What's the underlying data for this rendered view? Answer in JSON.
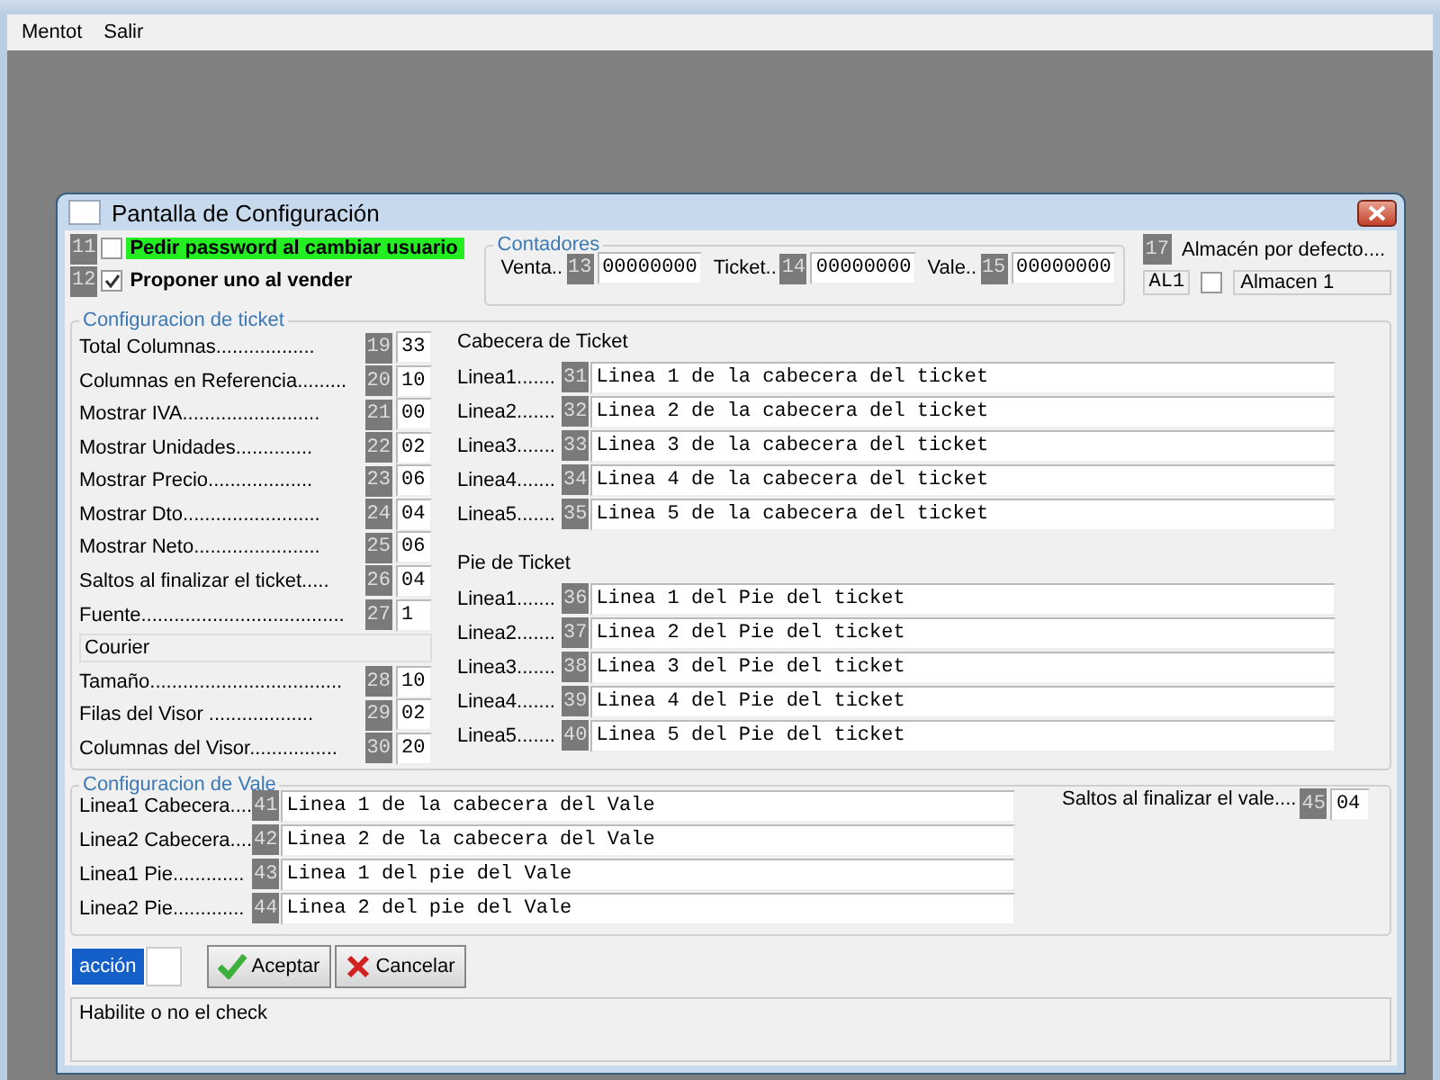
{
  "menu": [
    "Mentot",
    "Salir"
  ],
  "dialog": {
    "title": "Pantalla de Configuración",
    "options": [
      {
        "number": "11",
        "label": "Pedir password al cambiar usuario",
        "checked": false,
        "highlighted": true
      },
      {
        "number": "12",
        "label": "Proponer uno al vender",
        "checked": true,
        "highlighted": false
      }
    ],
    "contadores": {
      "title": "Contadores",
      "fields": [
        {
          "label": "Venta..",
          "number": "13",
          "value": "00000000"
        },
        {
          "label": "Ticket..",
          "number": "14",
          "value": "00000000"
        },
        {
          "label": "Vale..",
          "number": "15",
          "value": "00000000"
        }
      ]
    },
    "almacen": {
      "number": "17",
      "label": "Almacén por defecto....",
      "code": "AL1",
      "checked": false,
      "name": "Almacen 1"
    },
    "ticket_config": {
      "title": "Configuracion de ticket",
      "fields": [
        {
          "kind": "field",
          "label": "Total Columnas..................",
          "number": "19",
          "value": "33"
        },
        {
          "kind": "field",
          "label": "Columnas en Referencia.........",
          "number": "20",
          "value": "10"
        },
        {
          "kind": "field",
          "label": "Mostrar IVA.........................",
          "number": "21",
          "value": "00"
        },
        {
          "kind": "field",
          "label": "Mostrar Unidades..............",
          "number": "22",
          "value": "02"
        },
        {
          "kind": "field",
          "label": "Mostrar Precio...................",
          "number": "23",
          "value": "06"
        },
        {
          "kind": "field",
          "label": "Mostrar Dto.........................",
          "number": "24",
          "value": "04"
        },
        {
          "kind": "field",
          "label": "Mostrar Neto.......................",
          "number": "25",
          "value": "06"
        },
        {
          "kind": "field",
          "label": "Saltos al finalizar el ticket.....",
          "number": "26",
          "value": "04"
        },
        {
          "kind": "field",
          "label": "Fuente.....................................",
          "number": "27",
          "value": "1"
        },
        {
          "kind": "display",
          "value": "Courier"
        },
        {
          "kind": "field",
          "label": "Tamaño...................................",
          "number": "28",
          "value": "10"
        },
        {
          "kind": "field",
          "label": "Filas del Visor ...................",
          "number": "29",
          "value": "02"
        },
        {
          "kind": "field",
          "label": "Columnas del Visor................",
          "number": "30",
          "value": "20"
        }
      ]
    },
    "cabecera": {
      "title": "Cabecera de Ticket",
      "lines": [
        {
          "label": "Linea1.......",
          "number": "31",
          "value": "Linea 1 de la cabecera del ticket"
        },
        {
          "label": "Linea2.......",
          "number": "32",
          "value": "Linea 2 de la cabecera del ticket"
        },
        {
          "label": "Linea3.......",
          "number": "33",
          "value": "Linea 3 de la cabecera del ticket"
        },
        {
          "label": "Linea4.......",
          "number": "34",
          "value": "Linea 4 de la cabecera del ticket"
        },
        {
          "label": "Linea5.......",
          "number": "35",
          "value": "Linea 5 de la cabecera del ticket"
        }
      ]
    },
    "pie": {
      "title": "Pie de Ticket",
      "lines": [
        {
          "label": "Linea1.......",
          "number": "36",
          "value": "Linea 1 del Pie del ticket"
        },
        {
          "label": "Linea2.......",
          "number": "37",
          "value": "Linea 2 del Pie del ticket"
        },
        {
          "label": "Linea3.......",
          "number": "38",
          "value": "Linea 3 del Pie del ticket"
        },
        {
          "label": "Linea4.......",
          "number": "39",
          "value": "Linea 4 del Pie del ticket"
        },
        {
          "label": "Linea5.......",
          "number": "40",
          "value": "Linea 5 del Pie del ticket"
        }
      ]
    },
    "vale": {
      "title": "Configuracion de Vale",
      "lines": [
        {
          "label": "Linea1 Cabecera....",
          "number": "41",
          "value": "Linea 1 de la cabecera del Vale"
        },
        {
          "label": "Linea2 Cabecera....",
          "number": "42",
          "value": "Linea 2 de la cabecera del Vale"
        },
        {
          "label": "Linea1 Pie.............",
          "number": "43",
          "value": "Linea 1 del pie del Vale"
        },
        {
          "label": "Linea2 Pie.............",
          "number": "44",
          "value": "Linea 2 del pie del Vale"
        }
      ],
      "saltos": {
        "label": "Saltos al finalizar el vale....",
        "number": "45",
        "value": "04"
      }
    },
    "action_button": "acción",
    "buttons": [
      {
        "kind": "accept",
        "label": "Aceptar"
      },
      {
        "kind": "cancel",
        "label": "Cancelar"
      }
    ],
    "status": "Habilite o no el check"
  }
}
